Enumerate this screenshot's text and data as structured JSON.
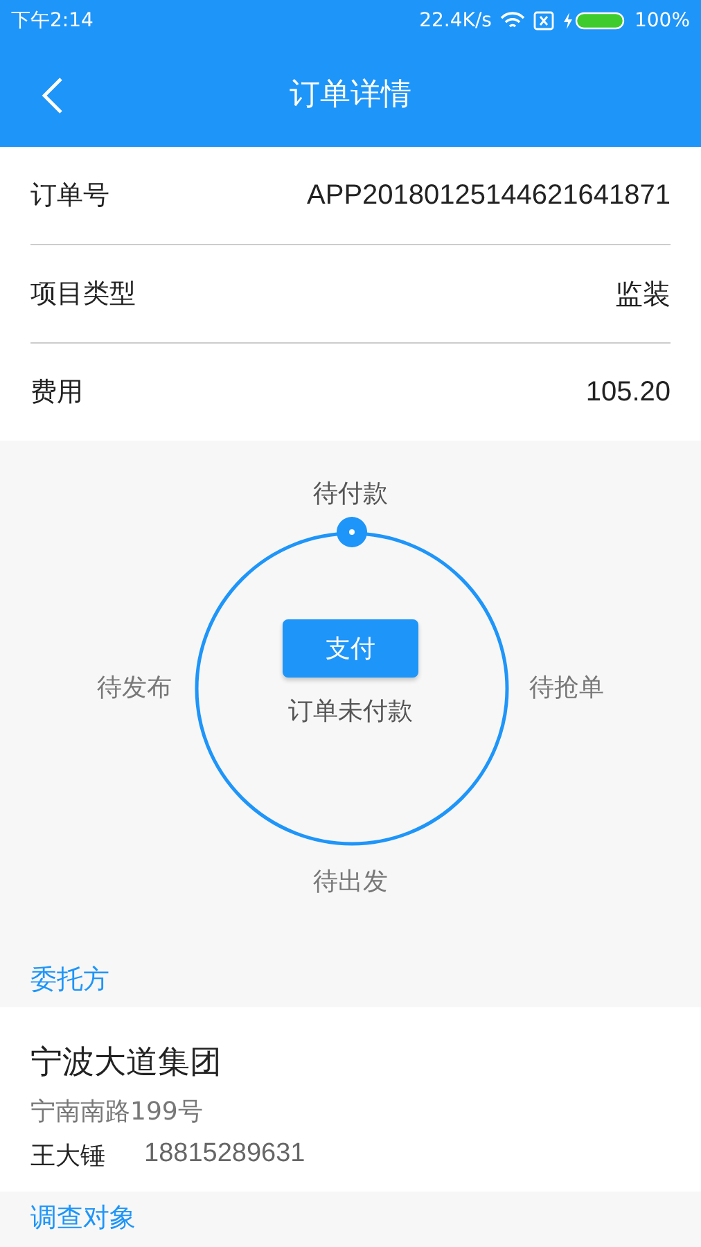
{
  "status_bar": {
    "time": "下午2:14",
    "speed": "22.4K/s",
    "battery": "100%"
  },
  "header": {
    "title": "订单详情"
  },
  "info_rows": [
    {
      "label": "订单号",
      "value": "APP20180125144621641871"
    },
    {
      "label": "项目类型",
      "value": "监装"
    },
    {
      "label": "费用",
      "value": "105.20"
    }
  ],
  "progress": {
    "steps": [
      {
        "label": "待付款",
        "selected": true
      },
      {
        "label": "待抢单",
        "selected": false
      },
      {
        "label": "待出发",
        "selected": false
      },
      {
        "label": "待发布",
        "selected": false
      }
    ],
    "button": "支付",
    "status_text": "订单未付款"
  },
  "client": {
    "section_title": "委托方",
    "company": "宁波大道集团",
    "address": "宁南南路199号",
    "contact_name": "王大锤",
    "phone": "18815289631"
  },
  "next_section": {
    "section_title": "调查对象"
  }
}
